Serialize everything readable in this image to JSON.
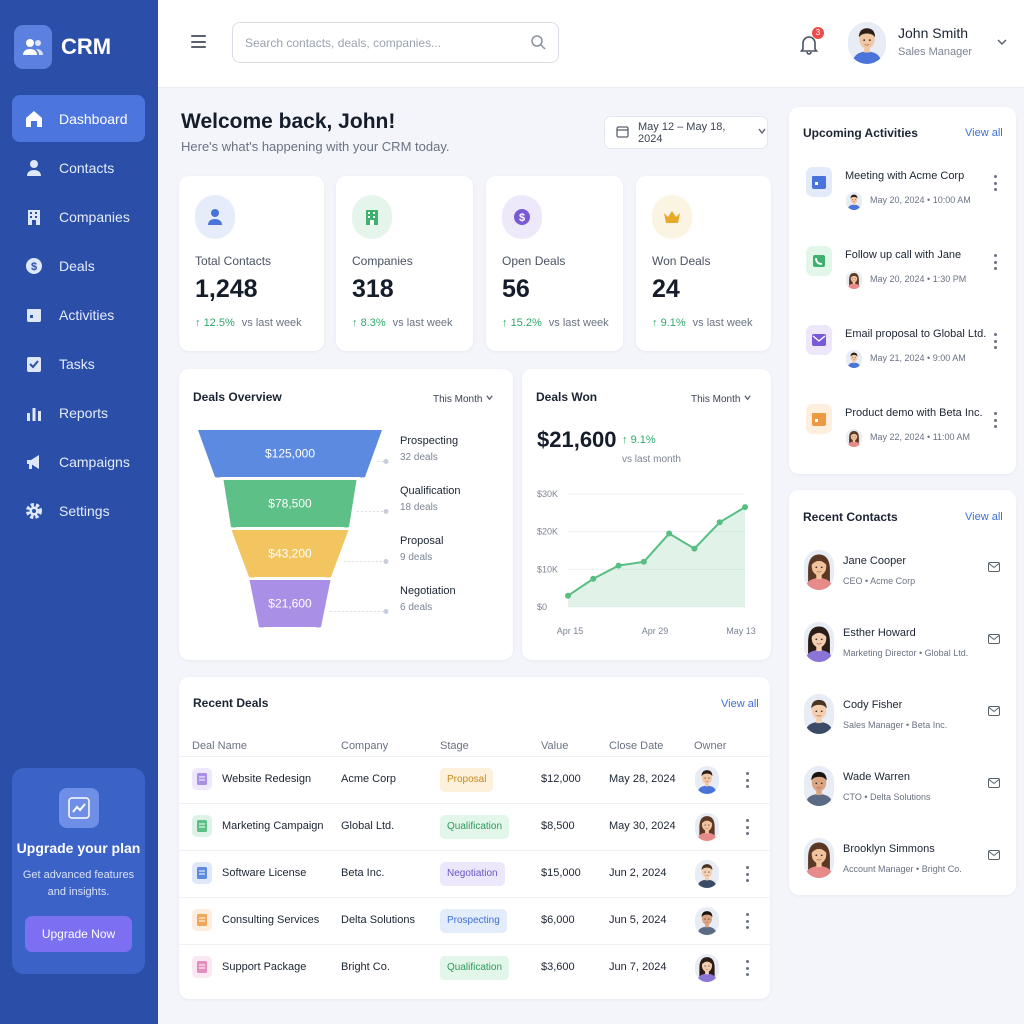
{
  "app": {
    "name": "CRM"
  },
  "sidebar": {
    "items": [
      {
        "label": "Dashboard",
        "icon": "home-icon",
        "active": true
      },
      {
        "label": "Contacts",
        "icon": "person-icon"
      },
      {
        "label": "Companies",
        "icon": "building-icon"
      },
      {
        "label": "Deals",
        "icon": "dollar-icon"
      },
      {
        "label": "Activities",
        "icon": "calendar-icon"
      },
      {
        "label": "Tasks",
        "icon": "checkbox-icon"
      },
      {
        "label": "Reports",
        "icon": "bar-chart-icon"
      },
      {
        "label": "Campaigns",
        "icon": "megaphone-icon"
      },
      {
        "label": "Settings",
        "icon": "gear-icon"
      }
    ],
    "upgrade": {
      "title": "Upgrade your plan",
      "desc": "Get advanced features and insights.",
      "button": "Upgrade Now"
    }
  },
  "topbar": {
    "search_placeholder": "Search contacts, deals, companies...",
    "notification_count": "3",
    "user": {
      "name": "John Smith",
      "role": "Sales Manager"
    }
  },
  "welcome": {
    "title": "Welcome back, John!",
    "subtitle": "Here's what's happening with your CRM today."
  },
  "date_range": "May 12 – May 18, 2024",
  "stats": [
    {
      "label": "Total Contacts",
      "value": "1,248",
      "change": "12.5%",
      "vs": "vs last week",
      "icon": "person-icon",
      "color": "#4a74d9"
    },
    {
      "label": "Companies",
      "value": "318",
      "change": "8.3%",
      "vs": "vs last week",
      "icon": "building-icon",
      "color": "#3fb16f"
    },
    {
      "label": "Open Deals",
      "value": "56",
      "change": "15.2%",
      "vs": "vs last week",
      "icon": "dollar-icon",
      "color": "#7a59d6"
    },
    {
      "label": "Won Deals",
      "value": "24",
      "change": "9.1%",
      "vs": "vs last week",
      "icon": "crown-icon",
      "color": "#e6a92a"
    }
  ],
  "deals_overview": {
    "title": "Deals Overview",
    "period": "This Month",
    "stages": [
      {
        "value": "$125,000",
        "name": "Prospecting",
        "count": "32 deals",
        "color": "#5b8ae0"
      },
      {
        "value": "$78,500",
        "name": "Qualification",
        "count": "18 deals",
        "color": "#5cc087"
      },
      {
        "value": "$43,200",
        "name": "Proposal",
        "count": "9 deals",
        "color": "#f2c561"
      },
      {
        "value": "$21,600",
        "name": "Negotiation",
        "count": "6 deals",
        "color": "#a98fe6"
      }
    ]
  },
  "deals_won": {
    "title": "Deals Won",
    "period": "This Month",
    "amount": "$21,600",
    "change": "9.1%",
    "vs": "vs last month"
  },
  "chart_data": {
    "type": "area",
    "y_ticks": [
      "$30K",
      "$20K",
      "$10K",
      "$0"
    ],
    "x_ticks": [
      "Apr 15",
      "Apr 29",
      "May 13"
    ],
    "ylim": [
      0,
      30000
    ],
    "values": [
      3000,
      7500,
      11000,
      12000,
      19500,
      15500,
      22500,
      26500
    ],
    "line_color": "#58be83",
    "grid": true
  },
  "recent_deals": {
    "title": "Recent Deals",
    "view_all": "View all",
    "columns": [
      "Deal Name",
      "Company",
      "Stage",
      "Value",
      "Close Date",
      "Owner"
    ],
    "rows": [
      {
        "name": "Website Redesign",
        "company": "Acme Corp",
        "stage": "Proposal",
        "value": "$12,000",
        "date": "May 28, 2024",
        "doc_color": "#a98fe6",
        "stage_bg": "#fdf1dc",
        "stage_fg": "#c58a1d",
        "owner": "man"
      },
      {
        "name": "Marketing Campaign",
        "company": "Global Ltd.",
        "stage": "Qualification",
        "value": "$8,500",
        "date": "May 30, 2024",
        "doc_color": "#5cc087",
        "stage_bg": "#e3f6ea",
        "stage_fg": "#2c9a5c",
        "owner": "woman"
      },
      {
        "name": "Software License",
        "company": "Beta Inc.",
        "stage": "Negotiation",
        "value": "$15,000",
        "date": "Jun 2, 2024",
        "doc_color": "#5b8ae0",
        "stage_bg": "#ece7fb",
        "stage_fg": "#6b54c7",
        "owner": "man2"
      },
      {
        "name": "Consulting Services",
        "company": "Delta Solutions",
        "stage": "Prospecting",
        "value": "$6,000",
        "date": "Jun 5, 2024",
        "doc_color": "#f2a65a",
        "stage_bg": "#e2ecfb",
        "stage_fg": "#3e6fd8",
        "owner": "man3"
      },
      {
        "name": "Support Package",
        "company": "Bright Co.",
        "stage": "Qualification",
        "value": "$3,600",
        "date": "Jun 7, 2024",
        "doc_color": "#e58fbf",
        "stage_bg": "#e3f6ea",
        "stage_fg": "#2c9a5c",
        "owner": "woman2"
      }
    ]
  },
  "upcoming": {
    "title": "Upcoming Activities",
    "view_all": "View all",
    "items": [
      {
        "title": "Meeting with Acme Corp",
        "time": "May 20, 2024  •  10:00 AM",
        "icon": "calendar-icon",
        "bg": "#e3ebfb",
        "fg": "#4a74d9",
        "av": "man"
      },
      {
        "title": "Follow up call with Jane",
        "time": "May 20, 2024  •  1:30 PM",
        "icon": "phone-icon",
        "bg": "#e3f6ea",
        "fg": "#3fb16f",
        "av": "woman"
      },
      {
        "title": "Email proposal to Global Ltd.",
        "time": "May 21, 2024  •  9:00 AM",
        "icon": "mail-icon",
        "bg": "#ece7fb",
        "fg": "#7a59d6",
        "av": "man"
      },
      {
        "title": "Product demo with Beta Inc.",
        "time": "May 22, 2024  •  11:00 AM",
        "icon": "calendar-icon",
        "bg": "#fdeedd",
        "fg": "#ec9a42",
        "av": "woman"
      }
    ]
  },
  "recent_contacts": {
    "title": "Recent Contacts",
    "view_all": "View all",
    "items": [
      {
        "name": "Jane Cooper",
        "role": "CEO  •  Acme Corp",
        "av": "woman"
      },
      {
        "name": "Esther Howard",
        "role": "Marketing Director  •  Global Ltd.",
        "av": "woman2"
      },
      {
        "name": "Cody Fisher",
        "role": "Sales Manager  •  Beta Inc.",
        "av": "man2"
      },
      {
        "name": "Wade Warren",
        "role": "CTO  •  Delta Solutions",
        "av": "man3"
      },
      {
        "name": "Brooklyn Simmons",
        "role": "Account Manager  •  Bright Co.",
        "av": "woman"
      }
    ]
  }
}
